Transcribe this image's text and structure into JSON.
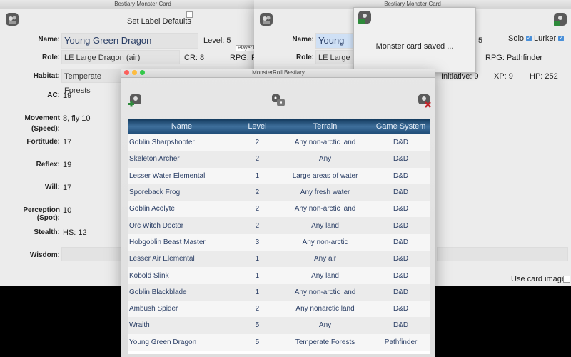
{
  "card_left": {
    "title": "Bestiary Monster Card",
    "set_label_defaults": "Set Label Defaults",
    "name_label": "Name:",
    "name_value": "Young Green Dragon",
    "level_label": "Level: 5",
    "role_label": "Role:",
    "role_value": "LE Large Dragon (air)",
    "cr_label": "CR: 8",
    "rpg_label": "RPG: Pa",
    "player_tooltip": "Player le",
    "habitat_label": "Habitat:",
    "habitat_value": "Temperate Forests",
    "stats": [
      {
        "label": "AC:",
        "value": "19"
      },
      {
        "label": "Movement",
        "label2": "(Speed):",
        "value": "8, fly 10"
      },
      {
        "label": "Fortitude:",
        "value": "17"
      },
      {
        "label": "Reflex:",
        "value": "19"
      },
      {
        "label": "Will:",
        "value": "17"
      },
      {
        "label": "Perception (Spot):",
        "value": "10"
      },
      {
        "label": "Stealth:",
        "value": "HS: 12"
      },
      {
        "label": "Wisdom:",
        "value": ""
      }
    ]
  },
  "card_right": {
    "title": "Bestiary Monster Card",
    "name_label": "Name:",
    "name_value": "Young Gre",
    "level_label": "5",
    "solo_label": "Solo",
    "lurker_label": "Lurker",
    "role_label": "Role:",
    "role_value": "LE Large Dra",
    "rpg_label": "RPG: Pathfinder",
    "initiative_label": "Initiative: 9",
    "xp_label": "XP: 9",
    "hp_label": "HP: 252",
    "use_card_image": "Use card image:"
  },
  "toast": {
    "message": "Monster card saved ..."
  },
  "roll": {
    "title": "MonsterRoll Bestiary",
    "headers": [
      "Name",
      "Level",
      "Terrain",
      "Game System"
    ],
    "rows": [
      {
        "name": "Goblin Sharpshooter",
        "level": "2",
        "terrain": "Any non-arctic land",
        "system": "D&D"
      },
      {
        "name": "Skeleton Archer",
        "level": "2",
        "terrain": "Any",
        "system": "D&D"
      },
      {
        "name": "Lesser Water Elemental",
        "level": "1",
        "terrain": "Large areas of water",
        "system": "D&D"
      },
      {
        "name": "Sporeback Frog",
        "level": "2",
        "terrain": "Any fresh water",
        "system": "D&D"
      },
      {
        "name": "Goblin Acolyte",
        "level": "2",
        "terrain": "Any non-arctic land",
        "system": "D&D"
      },
      {
        "name": "Orc Witch Doctor",
        "level": "2",
        "terrain": "Any land",
        "system": "D&D"
      },
      {
        "name": "Hobgoblin Beast Master",
        "level": "3",
        "terrain": "Any non-arctic",
        "system": "D&D"
      },
      {
        "name": "Lesser Air Elemental",
        "level": "1",
        "terrain": "Any air",
        "system": "D&D"
      },
      {
        "name": "Kobold Slink",
        "level": "1",
        "terrain": "Any land",
        "system": "D&D"
      },
      {
        "name": "Goblin Blackblade",
        "level": "1",
        "terrain": "Any non-arctic land",
        "system": "D&D"
      },
      {
        "name": "Ambush Spider",
        "level": "2",
        "terrain": "Any nonarctic land",
        "system": "D&D"
      },
      {
        "name": "Wraith",
        "level": "5",
        "terrain": "Any",
        "system": "D&D"
      },
      {
        "name": "Young Green Dragon",
        "level": "5",
        "terrain": "Temperate Forests",
        "system": "Pathfinder"
      }
    ]
  },
  "colors": {
    "header_bg": "#1f4e7a",
    "row_text": "#2b3f66",
    "accent": "#4a90d9",
    "name_text": "#2b3f66"
  }
}
